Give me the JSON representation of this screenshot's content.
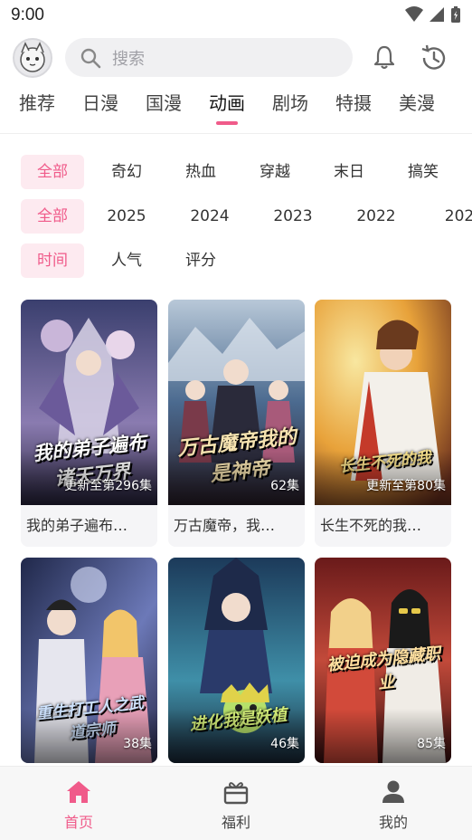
{
  "status_bar": {
    "time": "9:00"
  },
  "header": {
    "search_placeholder": "搜索"
  },
  "tabs": [
    {
      "label": "推荐",
      "active": false
    },
    {
      "label": "日漫",
      "active": false
    },
    {
      "label": "国漫",
      "active": false
    },
    {
      "label": "动画",
      "active": true
    },
    {
      "label": "剧场",
      "active": false
    },
    {
      "label": "特摄",
      "active": false
    },
    {
      "label": "美漫",
      "active": false
    }
  ],
  "filters": {
    "genre": [
      "全部",
      "奇幻",
      "热血",
      "穿越",
      "末日",
      "搞笑"
    ],
    "year": [
      "全部",
      "2025",
      "2024",
      "2023",
      "2022",
      "202"
    ],
    "sort": [
      "时间",
      "人气",
      "评分"
    ]
  },
  "cards": [
    {
      "title": "我的弟子遍布…",
      "episodes": "更新至第296集",
      "cover_text": "我的弟子遍布诸天万界",
      "colors": [
        "#3a3f6e",
        "#8a7bb0",
        "#c9b6d9"
      ]
    },
    {
      "title": "万古魔帝，我…",
      "episodes": "62集",
      "cover_text": "万古魔帝我的是神帝",
      "colors": [
        "#4b6a8f",
        "#b8c8d8",
        "#6b3a4a"
      ]
    },
    {
      "title": "长生不死的我…",
      "episodes": "更新至第80集",
      "cover_text": "长生不死的我",
      "colors": [
        "#e8a23a",
        "#f3d27a",
        "#6a2f1e"
      ]
    },
    {
      "title": "",
      "episodes": "38集",
      "cover_text": "重生打工人之武道宗师",
      "colors": [
        "#20284a",
        "#6c79b8",
        "#f2c9a8"
      ]
    },
    {
      "title": "",
      "episodes": "46集",
      "cover_text": "进化我是妖植",
      "colors": [
        "#1c3a5a",
        "#3f8fa8",
        "#b6e06a"
      ]
    },
    {
      "title": "",
      "episodes": "85集",
      "cover_text": "被迫成为隐藏职业",
      "colors": [
        "#6a1a1a",
        "#c24a3a",
        "#f4d3a8"
      ]
    }
  ],
  "bottom_nav": [
    {
      "label": "首页",
      "icon": "home-icon",
      "active": true
    },
    {
      "label": "福利",
      "icon": "gift-icon",
      "active": false
    },
    {
      "label": "我的",
      "icon": "profile-icon",
      "active": false
    }
  ],
  "colors": {
    "accent": "#f05b8a",
    "chip_bg": "#fdeaf0"
  }
}
